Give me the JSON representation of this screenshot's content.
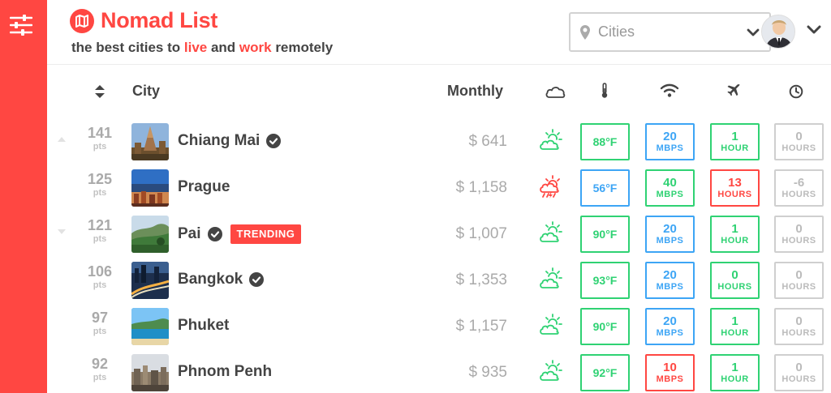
{
  "app": {
    "name": "Nomad List",
    "tagline_pre": "the best cities to ",
    "tagline_live": "live",
    "tagline_mid": " and ",
    "tagline_work": "work",
    "tagline_post": " remotely"
  },
  "search": {
    "value": "Cities"
  },
  "columns": {
    "city": "City",
    "monthly": "Monthly"
  },
  "colors": {
    "brand": "#ff4742",
    "good": "#2fd273",
    "info": "#3da5f5",
    "bad": "#ff4742",
    "muted": "#cfcfcf"
  },
  "rows": [
    {
      "points": "141",
      "pts_label": "pts",
      "trend": "up",
      "city": "Chiang Mai",
      "verified": true,
      "monthly": "$ 641",
      "weather": "cloudy-sun",
      "temp": "88°F",
      "temp_color": "green",
      "wifi": "20",
      "wifi_unit": "MBPS",
      "wifi_color": "blue",
      "flight": "1",
      "flight_unit": "HOUR",
      "flight_color": "green",
      "tz": "0",
      "tz_unit": "HOURS",
      "tz_color": "grey"
    },
    {
      "points": "125",
      "pts_label": "pts",
      "trend": "",
      "city": "Prague",
      "verified": false,
      "monthly": "$ 1,158",
      "weather": "rain",
      "temp": "56°F",
      "temp_color": "blue",
      "wifi": "40",
      "wifi_unit": "MBPS",
      "wifi_color": "green",
      "flight": "13",
      "flight_unit": "HOURS",
      "flight_color": "red",
      "tz": "-6",
      "tz_unit": "HOURS",
      "tz_color": "grey"
    },
    {
      "points": "121",
      "pts_label": "pts",
      "trend": "down",
      "city": "Pai",
      "verified": true,
      "badge": "TRENDING",
      "monthly": "$ 1,007",
      "weather": "cloudy-sun",
      "temp": "90°F",
      "temp_color": "green",
      "wifi": "20",
      "wifi_unit": "MBPS",
      "wifi_color": "blue",
      "flight": "1",
      "flight_unit": "HOUR",
      "flight_color": "green",
      "tz": "0",
      "tz_unit": "HOURS",
      "tz_color": "grey"
    },
    {
      "points": "106",
      "pts_label": "pts",
      "trend": "",
      "city": "Bangkok",
      "verified": true,
      "monthly": "$ 1,353",
      "weather": "cloudy-sun",
      "temp": "93°F",
      "temp_color": "green",
      "wifi": "20",
      "wifi_unit": "MBPS",
      "wifi_color": "blue",
      "flight": "0",
      "flight_unit": "HOURS",
      "flight_color": "green",
      "tz": "0",
      "tz_unit": "HOURS",
      "tz_color": "grey"
    },
    {
      "points": "97",
      "pts_label": "pts",
      "trend": "",
      "city": "Phuket",
      "verified": false,
      "monthly": "$ 1,157",
      "weather": "cloudy-sun",
      "temp": "90°F",
      "temp_color": "green",
      "wifi": "20",
      "wifi_unit": "MBPS",
      "wifi_color": "blue",
      "flight": "1",
      "flight_unit": "HOUR",
      "flight_color": "green",
      "tz": "0",
      "tz_unit": "HOURS",
      "tz_color": "grey"
    },
    {
      "points": "92",
      "pts_label": "pts",
      "trend": "",
      "city": "Phnom Penh",
      "verified": false,
      "monthly": "$ 935",
      "weather": "cloudy-sun",
      "temp": "92°F",
      "temp_color": "green",
      "wifi": "10",
      "wifi_unit": "MBPS",
      "wifi_color": "red",
      "flight": "1",
      "flight_unit": "HOUR",
      "flight_color": "green",
      "tz": "0",
      "tz_unit": "HOURS",
      "tz_color": "grey"
    }
  ]
}
